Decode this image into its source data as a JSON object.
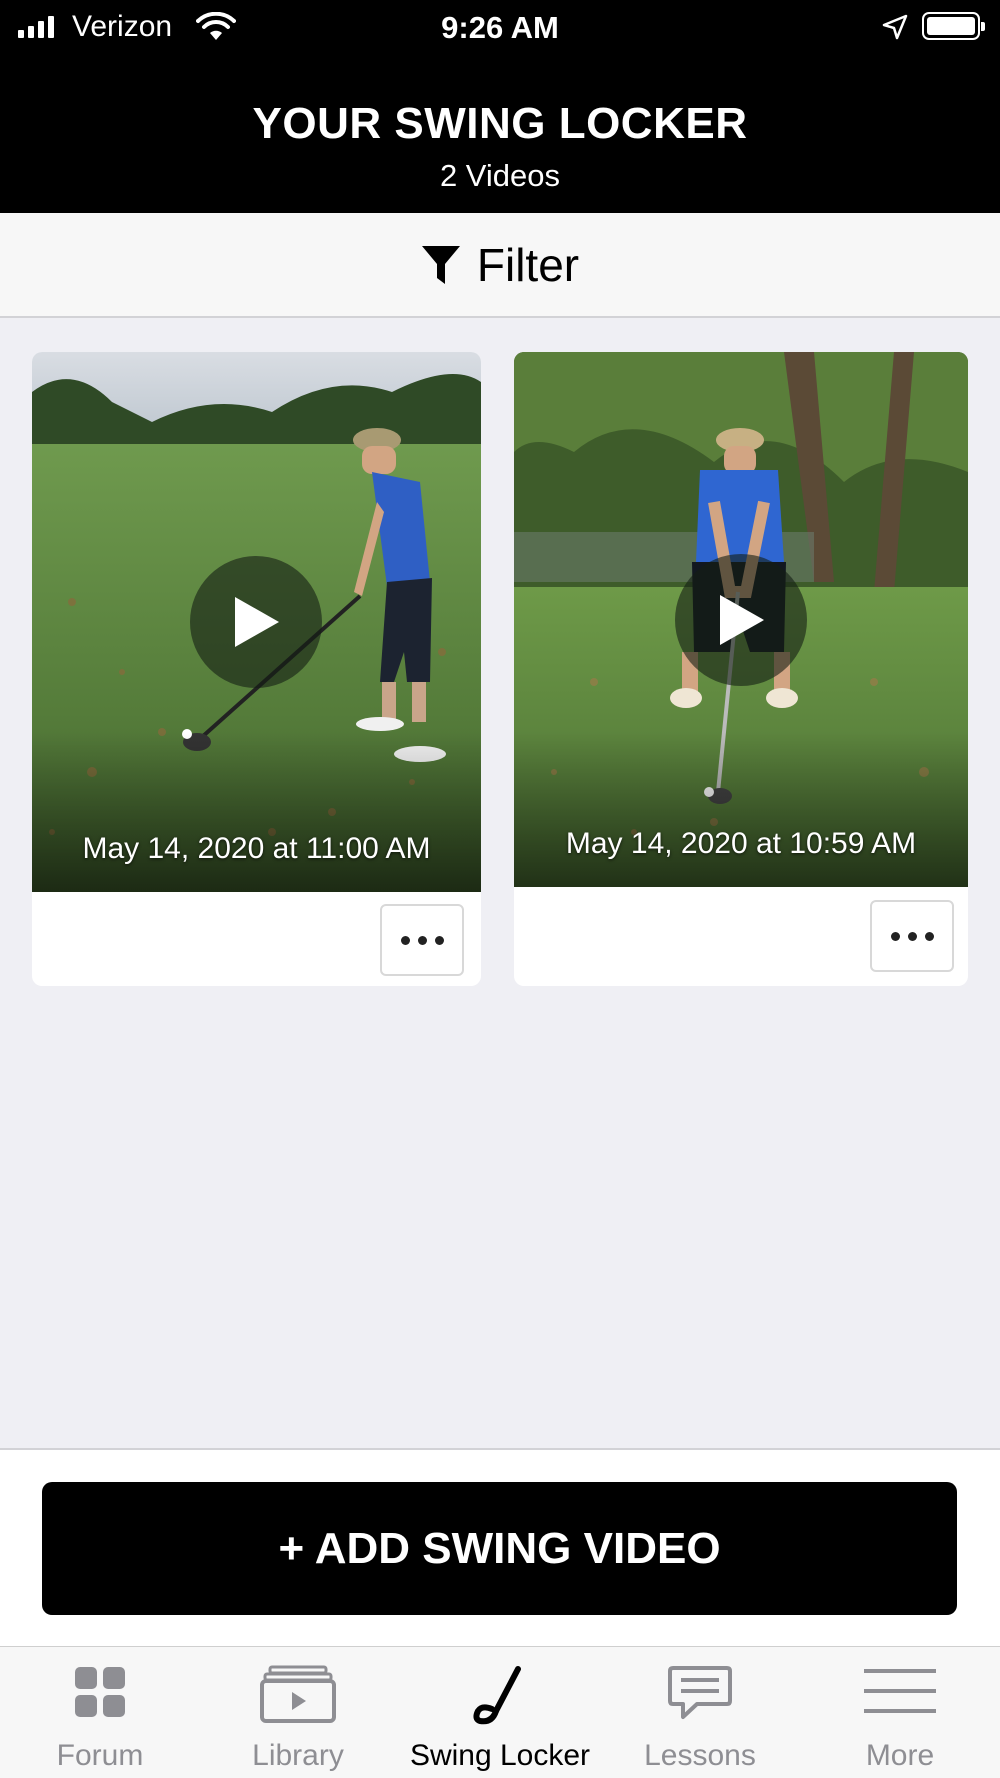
{
  "status_bar": {
    "carrier": "Verizon",
    "time": "9:26 AM"
  },
  "header": {
    "title": "YOUR SWING LOCKER",
    "subtitle": "2 Videos"
  },
  "filter": {
    "label": "Filter",
    "icon": "filter-funnel-icon"
  },
  "videos": [
    {
      "date": "May 14, 2020 at 11:00 AM"
    },
    {
      "date": "May 14, 2020 at 10:59 AM"
    }
  ],
  "add_button": {
    "label": "+ ADD SWING VIDEO"
  },
  "tabs": [
    {
      "label": "Forum",
      "icon": "grid-icon",
      "active": false
    },
    {
      "label": "Library",
      "icon": "library-icon",
      "active": false
    },
    {
      "label": "Swing Locker",
      "icon": "golf-club-icon",
      "active": true
    },
    {
      "label": "Lessons",
      "icon": "chat-icon",
      "active": false
    },
    {
      "label": "More",
      "icon": "menu-icon",
      "active": false
    }
  ]
}
